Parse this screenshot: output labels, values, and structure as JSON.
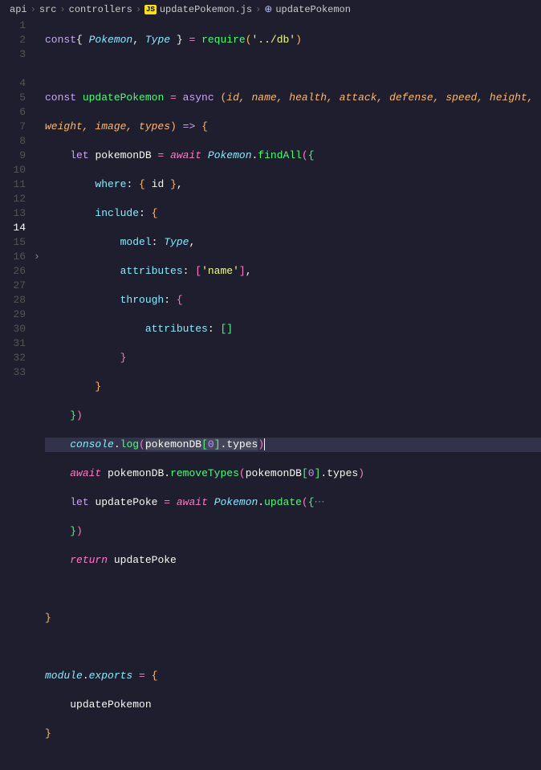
{
  "breadcrumb": {
    "parts": [
      "api",
      "src",
      "controllers",
      "updatePokemon.js",
      "updatePokemon"
    ],
    "jsBadge": "JS"
  },
  "gutter": {
    "lines": [
      "1",
      "2",
      "3",
      "4",
      "5",
      "6",
      "7",
      "8",
      "9",
      "10",
      "11",
      "12",
      "13",
      "14",
      "15",
      "16",
      "26",
      "27",
      "28",
      "29",
      "30",
      "31",
      "32",
      "33"
    ],
    "activeLine": "14"
  },
  "fold": {
    "chevron": "›",
    "foldedAt": "16"
  },
  "code": {
    "l1": {
      "const": "const",
      "lb": "{ ",
      "p": "Pokemon",
      "c1": ", ",
      "t": "Type",
      "rb": " }",
      "eq": " = ",
      "req": "require",
      "lp": "(",
      "str": "'../db'",
      "rp": ")"
    },
    "l3": {
      "const": "const",
      "sp": " ",
      "name": "updatePokemon",
      "eq": " = ",
      "async": "async",
      "lp": " (",
      "params": "id, name, health, attack, defense, speed, height,"
    },
    "l3b": {
      "params": "weight, image, types",
      "rp": ")",
      "arrow": " => ",
      "lb": "{"
    },
    "l4": {
      "let": "let",
      "sp": " ",
      "v": "pokemonDB",
      "eq": " = ",
      "await": "await",
      "sp2": " ",
      "obj": "Pokemon",
      "dot": ".",
      "fn": "findAll",
      "lp": "(",
      "lb": "{"
    },
    "l5": {
      "key": "where",
      "colon": ": ",
      "lb": "{ ",
      "id": "id",
      "rb": " }",
      "comma": ","
    },
    "l6": {
      "key": "include",
      "colon": ": ",
      "lb": "{"
    },
    "l7": {
      "key": "model",
      "colon": ": ",
      "val": "Type",
      "comma": ","
    },
    "l8": {
      "key": "attributes",
      "colon": ": ",
      "lb": "[",
      "str": "'name'",
      "rb": "]",
      "comma": ","
    },
    "l9": {
      "key": "through",
      "colon": ": ",
      "lb": "{"
    },
    "l10": {
      "key": "attributes",
      "colon": ": ",
      "lb": "[",
      "rb": "]"
    },
    "l11": {
      "rb": "}"
    },
    "l12": {
      "rb": "}"
    },
    "l13": {
      "rb": "}",
      "rp": ")"
    },
    "l14": {
      "obj": "console",
      "dot": ".",
      "fn": "log",
      "lp": "(",
      "v": "pokemonDB",
      "lb": "[",
      "n": "0",
      "rb": "]",
      "dot2": ".",
      "prop": "types",
      "rp": ")"
    },
    "l15": {
      "await": "await",
      "sp": " ",
      "v": "pokemonDB",
      "dot": ".",
      "fn": "removeTypes",
      "lp": "(",
      "v2": "pokemonDB",
      "lb": "[",
      "n": "0",
      "rb": "]",
      "dot2": ".",
      "prop": "types",
      "rp": ")"
    },
    "l16": {
      "let": "let",
      "sp": " ",
      "v": "updatePoke",
      "eq": " = ",
      "await": "await",
      "sp2": " ",
      "obj": "Pokemon",
      "dot": ".",
      "fn": "update",
      "lp": "(",
      "lb": "{",
      "dots": "⋯"
    },
    "l26": {
      "rb": "}",
      "rp": ")"
    },
    "l27": {
      "ret": "return",
      "sp": " ",
      "v": "updatePoke"
    },
    "l29": {
      "rb": "}"
    },
    "l31": {
      "mod": "module",
      "dot": ".",
      "exp": "exports",
      "eq": " = ",
      "lb": "{"
    },
    "l32": {
      "v": "updatePokemon"
    },
    "l33": {
      "rb": "}"
    }
  }
}
